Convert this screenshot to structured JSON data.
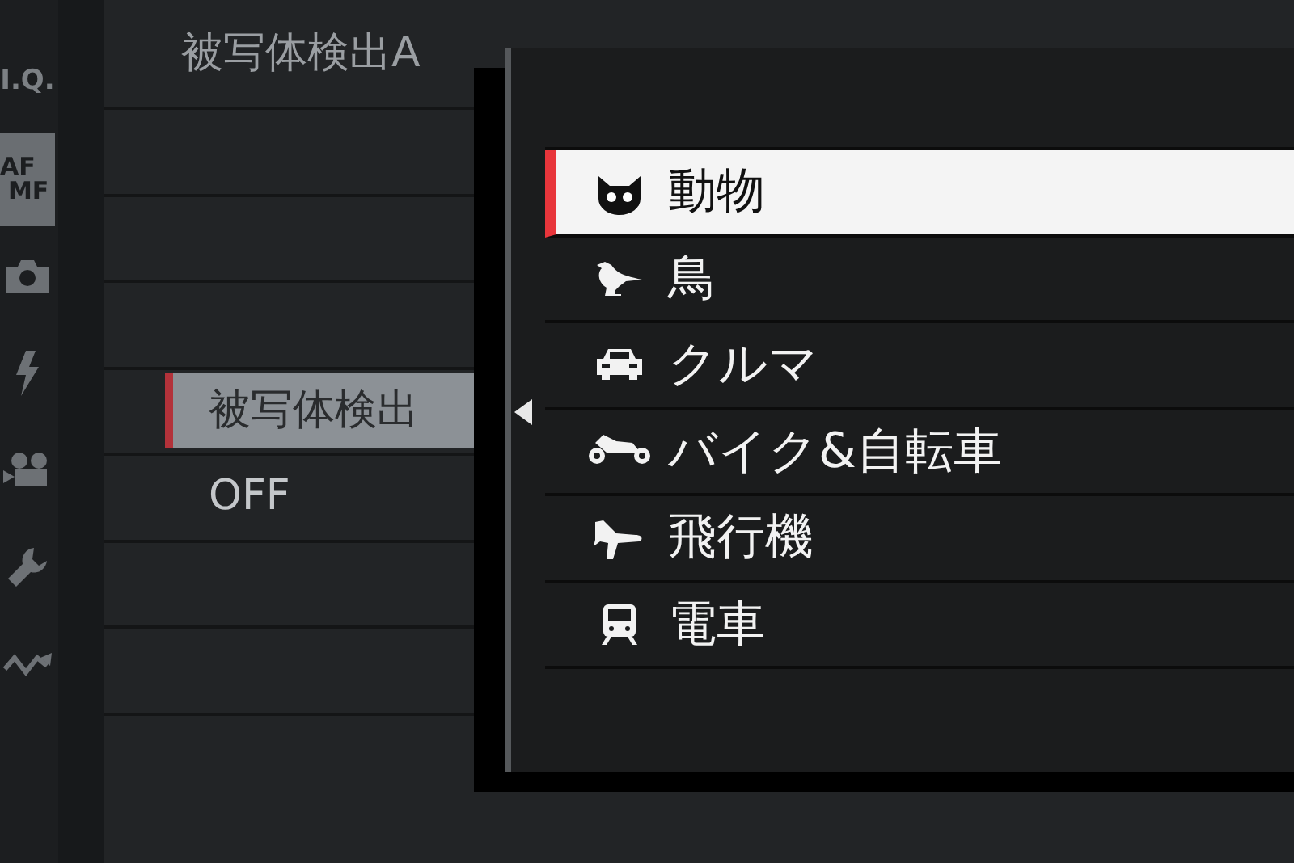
{
  "sidebar": {
    "tabs": [
      {
        "kind": "text",
        "label": "I.Q.",
        "selected": false
      },
      {
        "kind": "stacked",
        "label": "AF",
        "label_2": "MF",
        "selected": true
      },
      {
        "kind": "camera",
        "selected": false
      },
      {
        "kind": "flash",
        "selected": false
      },
      {
        "kind": "movie",
        "selected": false
      },
      {
        "kind": "wrench",
        "selected": false
      },
      {
        "kind": "wave",
        "selected": false
      }
    ]
  },
  "menu": {
    "title": "被写体検出A",
    "options": [
      {
        "label": "被写体検出",
        "selected": true
      },
      {
        "label": "OFF",
        "selected": false
      }
    ]
  },
  "popup": {
    "items": [
      {
        "kind": "animal",
        "label": "動物",
        "selected": true
      },
      {
        "kind": "bird",
        "label": "鳥",
        "selected": false
      },
      {
        "kind": "car",
        "label": "クルマ",
        "selected": false
      },
      {
        "kind": "bike",
        "label": "バイク&自転車",
        "selected": false
      },
      {
        "kind": "plane",
        "label": "飛行機",
        "selected": false
      },
      {
        "kind": "train",
        "label": "電車",
        "selected": false
      }
    ]
  }
}
